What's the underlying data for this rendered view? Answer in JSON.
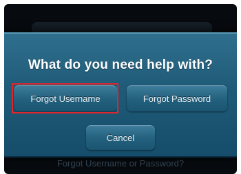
{
  "background": {
    "footer_text": "Forgot Username or Password?"
  },
  "dialog": {
    "title": "What do you need help with?",
    "buttons": {
      "forgot_username": "Forgot Username",
      "forgot_password": "Forgot Password",
      "cancel": "Cancel"
    }
  },
  "colors": {
    "dialog_accent": "#1f5b79",
    "highlight": "#e0262b"
  }
}
